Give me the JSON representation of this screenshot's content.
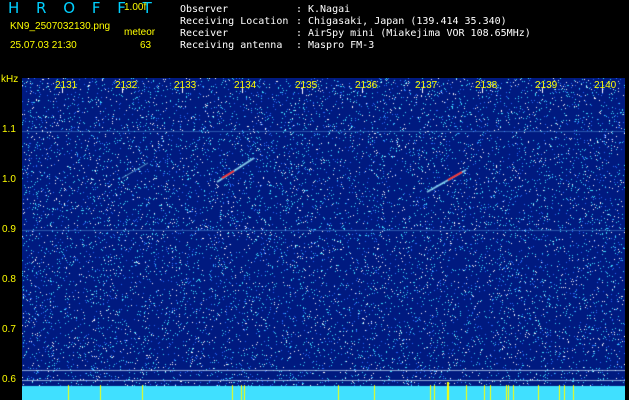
{
  "header": {
    "app_title": "H R O F F T",
    "version": "1.00f",
    "filename": "KN9_2507032130.png",
    "meteor_label": "meteor",
    "datetime": "25.07.03 21:30",
    "meteor_count": "63"
  },
  "info": [
    {
      "key": "Observer",
      "sep": ":",
      "value": "K.Nagai"
    },
    {
      "key": "Receiving Location",
      "sep": ":",
      "value": "Chigasaki, Japan (139.414 35.340)"
    },
    {
      "key": "Receiver",
      "sep": ":",
      "value": "AirSpy mini (Miakejima VOR 108.65MHz)"
    },
    {
      "key": "Receiving antenna",
      "sep": ":",
      "value": "Maspro FM-3"
    }
  ],
  "axis": {
    "unit": "kHz",
    "y_ticks": [
      "1.1",
      "1.0",
      "0.9",
      "0.8",
      "0.7",
      "0.6"
    ],
    "x_ticks": [
      "2131",
      "2132",
      "2133",
      "2134",
      "2135",
      "2136",
      "2137",
      "2138",
      "2139",
      "2140"
    ]
  },
  "colors": {
    "background": "#001a80",
    "noise_cyan": "#40e0ff",
    "noise_white": "#ffffff",
    "label_yellow": "#ffff00",
    "title_cyan": "#00d0ff",
    "echo_red": "#ff3030"
  }
}
